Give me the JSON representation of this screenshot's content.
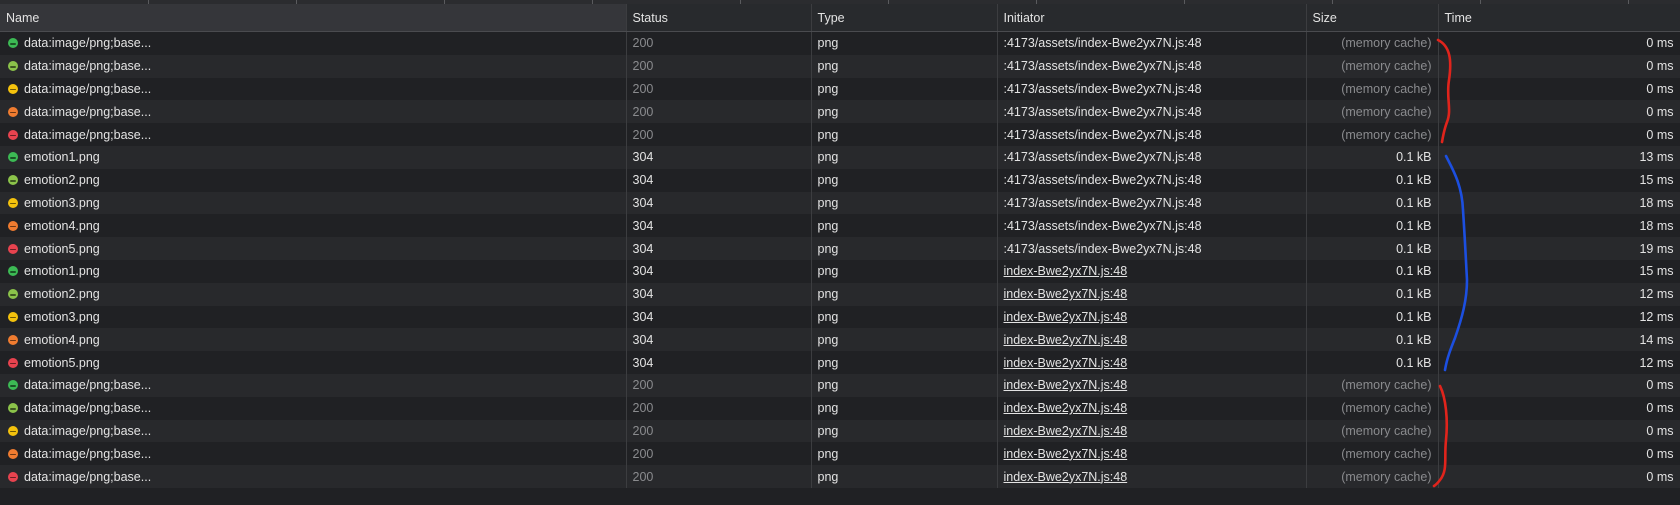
{
  "colors": {
    "background": "#202124",
    "row_alt": "#28292c",
    "header": "#282a2d",
    "text": "#e3e3e3",
    "dim_text": "#8a8b8e",
    "red_annotation": "#e0241c",
    "blue_annotation": "#1c4fe0"
  },
  "header": {
    "name": "Name",
    "status": "Status",
    "type": "Type",
    "initiator": "Initiator",
    "size": "Size",
    "time": "Time"
  },
  "rows": [
    {
      "name": "data:image/png;base...",
      "status": "200",
      "type": "png",
      "initiator": ":4173/assets/index-Bwe2yx7N.js:48",
      "size": "(memory cache)",
      "time": "0 ms",
      "color": "#3cba54",
      "link": false
    },
    {
      "name": "data:image/png;base...",
      "status": "200",
      "type": "png",
      "initiator": ":4173/assets/index-Bwe2yx7N.js:48",
      "size": "(memory cache)",
      "time": "0 ms",
      "color": "#8bc34a",
      "link": false
    },
    {
      "name": "data:image/png;base...",
      "status": "200",
      "type": "png",
      "initiator": ":4173/assets/index-Bwe2yx7N.js:48",
      "size": "(memory cache)",
      "time": "0 ms",
      "color": "#f4c20d",
      "link": false
    },
    {
      "name": "data:image/png;base...",
      "status": "200",
      "type": "png",
      "initiator": ":4173/assets/index-Bwe2yx7N.js:48",
      "size": "(memory cache)",
      "time": "0 ms",
      "color": "#f07c30",
      "link": false
    },
    {
      "name": "data:image/png;base...",
      "status": "200",
      "type": "png",
      "initiator": ":4173/assets/index-Bwe2yx7N.js:48",
      "size": "(memory cache)",
      "time": "0 ms",
      "color": "#e8434f",
      "link": false
    },
    {
      "name": "emotion1.png",
      "status": "304",
      "type": "png",
      "initiator": ":4173/assets/index-Bwe2yx7N.js:48",
      "size": "0.1 kB",
      "time": "13 ms",
      "color": "#3cba54",
      "link": false
    },
    {
      "name": "emotion2.png",
      "status": "304",
      "type": "png",
      "initiator": ":4173/assets/index-Bwe2yx7N.js:48",
      "size": "0.1 kB",
      "time": "15 ms",
      "color": "#8bc34a",
      "link": false
    },
    {
      "name": "emotion3.png",
      "status": "304",
      "type": "png",
      "initiator": ":4173/assets/index-Bwe2yx7N.js:48",
      "size": "0.1 kB",
      "time": "18 ms",
      "color": "#f4c20d",
      "link": false
    },
    {
      "name": "emotion4.png",
      "status": "304",
      "type": "png",
      "initiator": ":4173/assets/index-Bwe2yx7N.js:48",
      "size": "0.1 kB",
      "time": "18 ms",
      "color": "#f07c30",
      "link": false
    },
    {
      "name": "emotion5.png",
      "status": "304",
      "type": "png",
      "initiator": ":4173/assets/index-Bwe2yx7N.js:48",
      "size": "0.1 kB",
      "time": "19 ms",
      "color": "#e8434f",
      "link": false
    },
    {
      "name": "emotion1.png",
      "status": "304",
      "type": "png",
      "initiator": "index-Bwe2yx7N.js:48",
      "size": "0.1 kB",
      "time": "15 ms",
      "color": "#3cba54",
      "link": true
    },
    {
      "name": "emotion2.png",
      "status": "304",
      "type": "png",
      "initiator": "index-Bwe2yx7N.js:48",
      "size": "0.1 kB",
      "time": "12 ms",
      "color": "#8bc34a",
      "link": true
    },
    {
      "name": "emotion3.png",
      "status": "304",
      "type": "png",
      "initiator": "index-Bwe2yx7N.js:48",
      "size": "0.1 kB",
      "time": "12 ms",
      "color": "#f4c20d",
      "link": true
    },
    {
      "name": "emotion4.png",
      "status": "304",
      "type": "png",
      "initiator": "index-Bwe2yx7N.js:48",
      "size": "0.1 kB",
      "time": "14 ms",
      "color": "#f07c30",
      "link": true
    },
    {
      "name": "emotion5.png",
      "status": "304",
      "type": "png",
      "initiator": "index-Bwe2yx7N.js:48",
      "size": "0.1 kB",
      "time": "12 ms",
      "color": "#e8434f",
      "link": true
    },
    {
      "name": "data:image/png;base...",
      "status": "200",
      "type": "png",
      "initiator": "index-Bwe2yx7N.js:48",
      "size": "(memory cache)",
      "time": "0 ms",
      "color": "#3cba54",
      "link": true
    },
    {
      "name": "data:image/png;base...",
      "status": "200",
      "type": "png",
      "initiator": "index-Bwe2yx7N.js:48",
      "size": "(memory cache)",
      "time": "0 ms",
      "color": "#8bc34a",
      "link": true
    },
    {
      "name": "data:image/png;base...",
      "status": "200",
      "type": "png",
      "initiator": "index-Bwe2yx7N.js:48",
      "size": "(memory cache)",
      "time": "0 ms",
      "color": "#f4c20d",
      "link": true
    },
    {
      "name": "data:image/png;base...",
      "status": "200",
      "type": "png",
      "initiator": "index-Bwe2yx7N.js:48",
      "size": "(memory cache)",
      "time": "0 ms",
      "color": "#f07c30",
      "link": true
    },
    {
      "name": "data:image/png;base...",
      "status": "200",
      "type": "png",
      "initiator": "index-Bwe2yx7N.js:48",
      "size": "(memory cache)",
      "time": "0 ms",
      "color": "#e8434f",
      "link": true
    }
  ]
}
